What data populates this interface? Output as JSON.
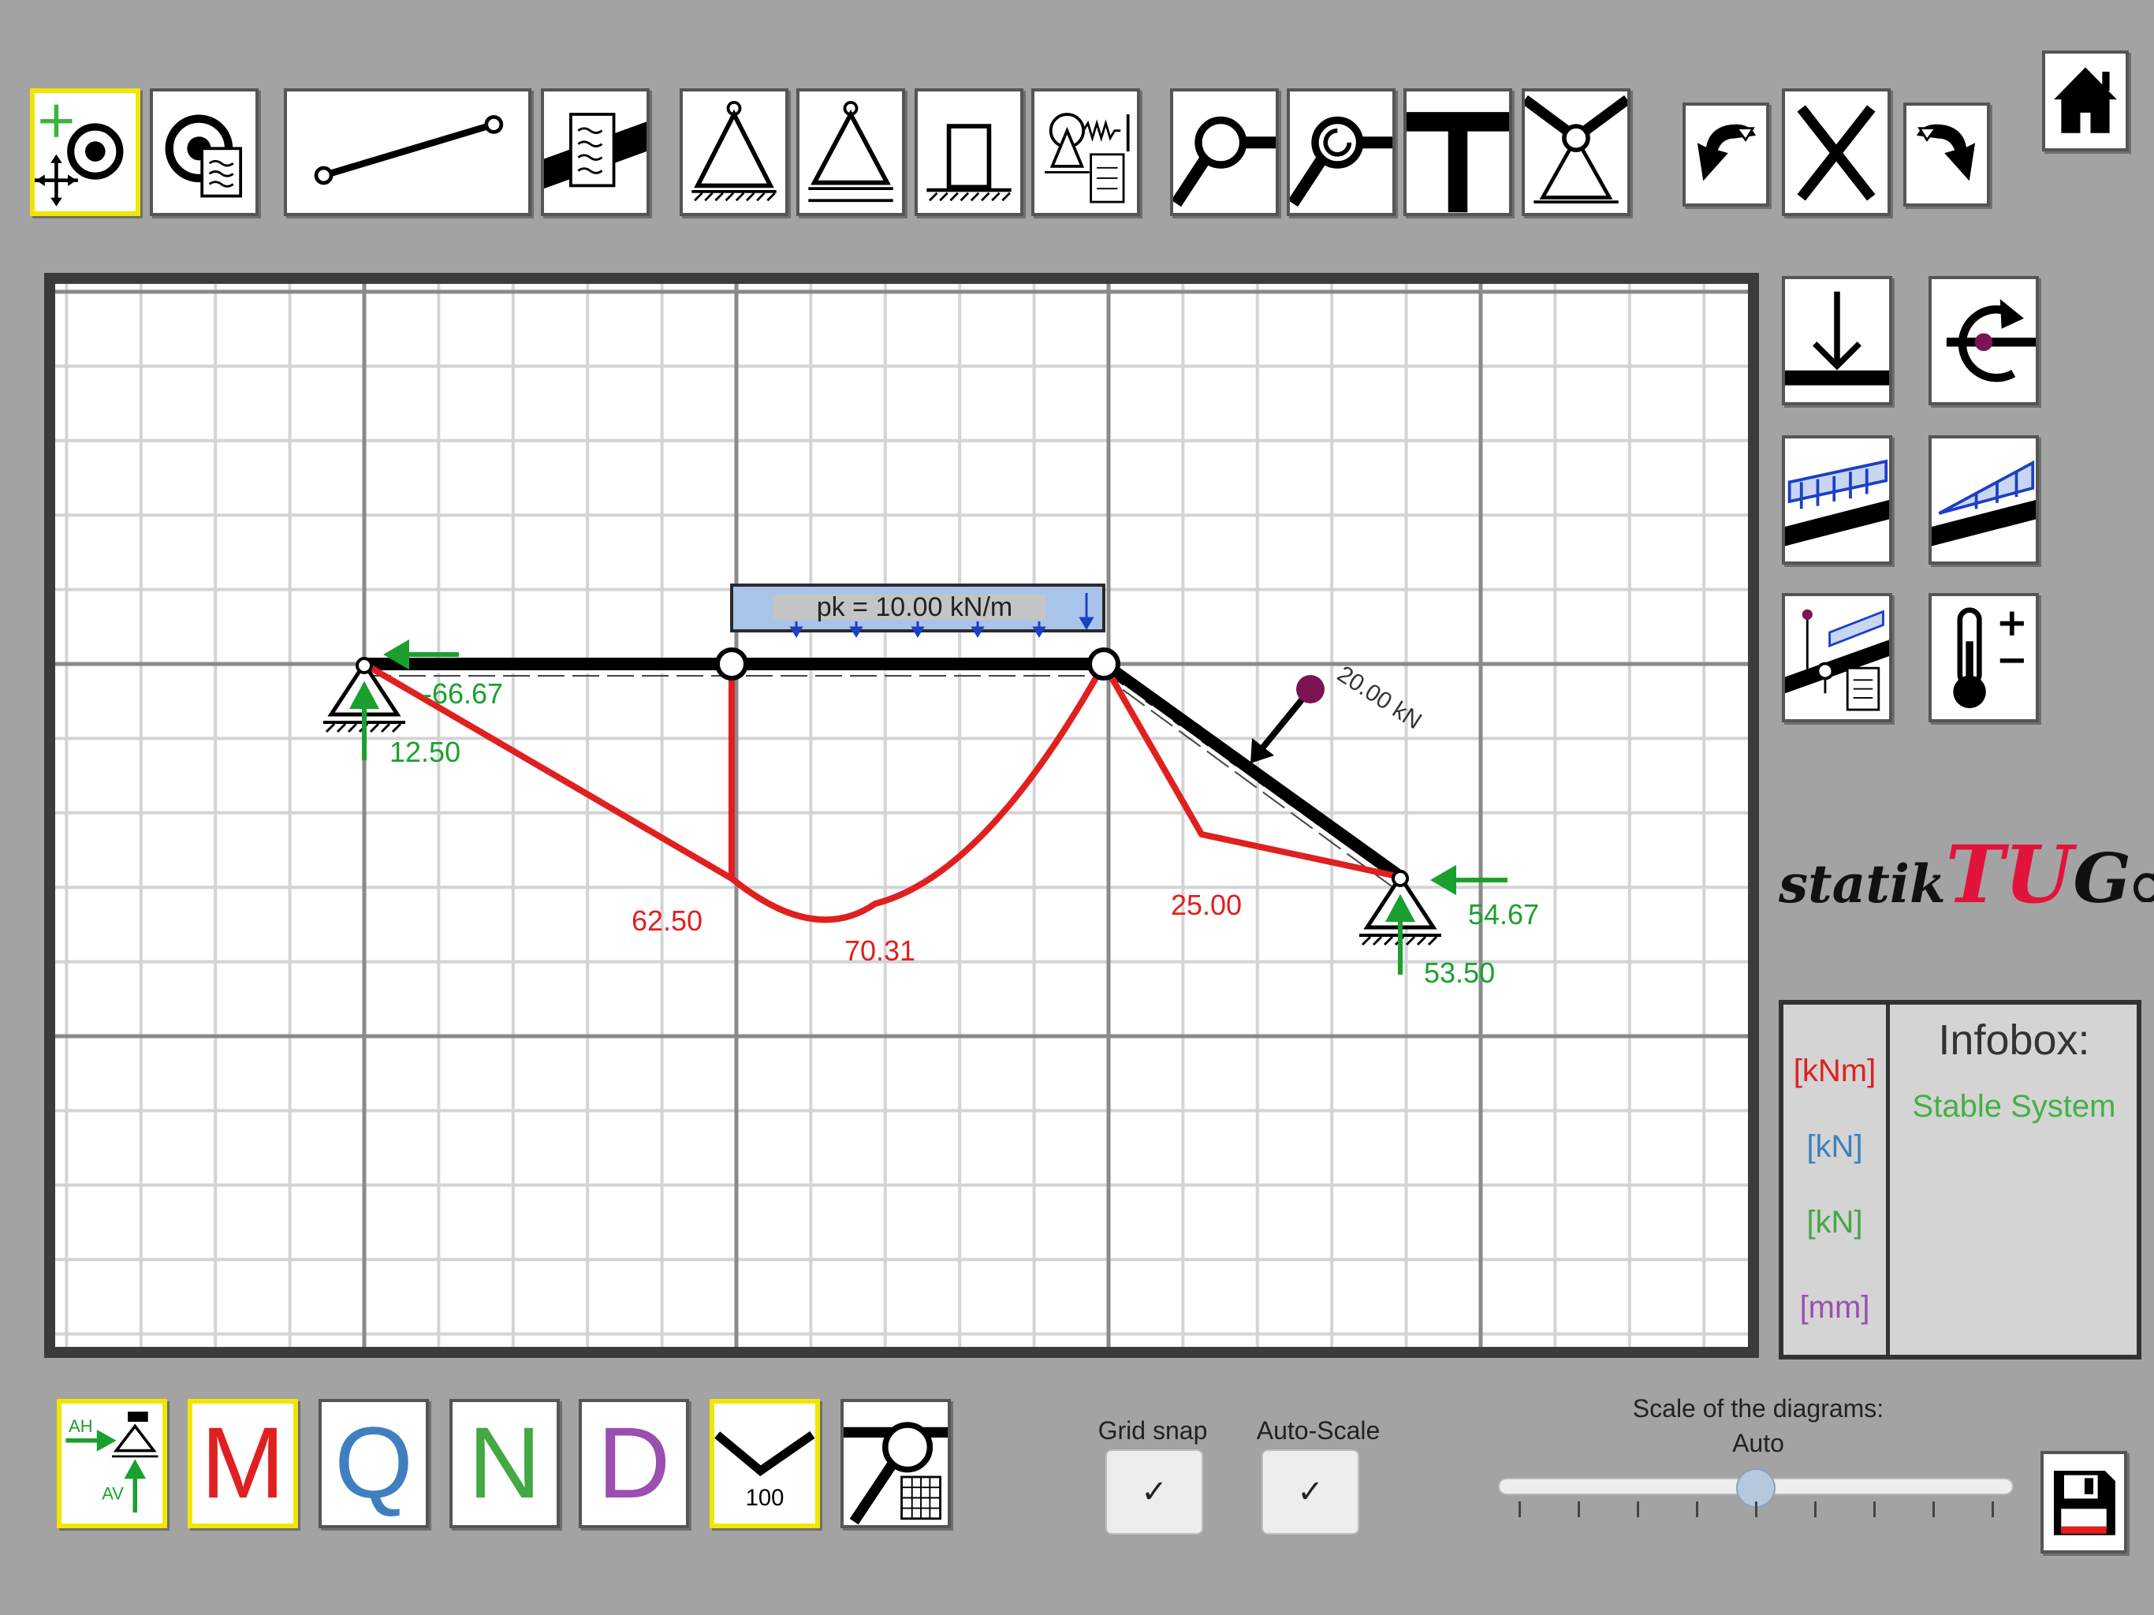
{
  "canvas": {
    "distributed_load_label": "pk = 10.00 kN/m",
    "point_load_label": "20.00 kN",
    "moment_values": [
      "62.50",
      "70.31",
      "25.00"
    ],
    "reactions": {
      "left_horizontal": "-66.67",
      "left_vertical": "12.50",
      "right_horizontal": "54.67",
      "right_vertical": "53.50"
    }
  },
  "logo": {
    "part1": "statik",
    "part2": "TU",
    "part3": "G"
  },
  "infobox": {
    "title": "Infobox:",
    "status": "Stable System",
    "units": [
      "[kNm]",
      "[kN]",
      "[kN]",
      "[mm]"
    ]
  },
  "bottom_bar": {
    "reactions_button": {
      "h_label": "AH",
      "v_label": "AV"
    },
    "diagram_buttons": [
      "M",
      "Q",
      "N",
      "D"
    ],
    "deformation_scale": "100",
    "grid_snap_label": "Grid snap",
    "grid_snap_checked": true,
    "auto_scale_label": "Auto-Scale",
    "auto_scale_checked": true,
    "check_mark": "✓",
    "scale_label": "Scale of the diagrams:",
    "scale_value": "Auto",
    "scale_fraction": 0.5
  },
  "colors": {
    "moment": "#e02020",
    "shear": "#3f7fbf",
    "normal": "#44a844",
    "deformation": "#9b4fb0",
    "reaction": "#1aa02e",
    "load": "#1d3fc4",
    "active_border": "#f2e600"
  },
  "icons": {
    "top_toolbar": [
      "select-move-icon",
      "node-properties-icon",
      "beam-icon",
      "beam-properties-icon",
      "pinned-support-icon",
      "roller-support-icon",
      "fixed-support-icon",
      "spring-support-icon",
      "hinge-icon",
      "hinge-properties-icon",
      "rigid-joint-icon",
      "support-hinge-icon",
      "undo-icon",
      "delete-icon",
      "redo-icon",
      "home-icon"
    ],
    "right_toolbar": [
      "point-load-icon",
      "moment-load-icon",
      "uniform-load-icon",
      "trapezoid-load-icon",
      "inclined-load-icon",
      "temperature-icon"
    ],
    "bottom_toolbar": [
      "reactions-icon",
      "deformation-icon",
      "hinge-grid-icon",
      "save-icon"
    ]
  }
}
